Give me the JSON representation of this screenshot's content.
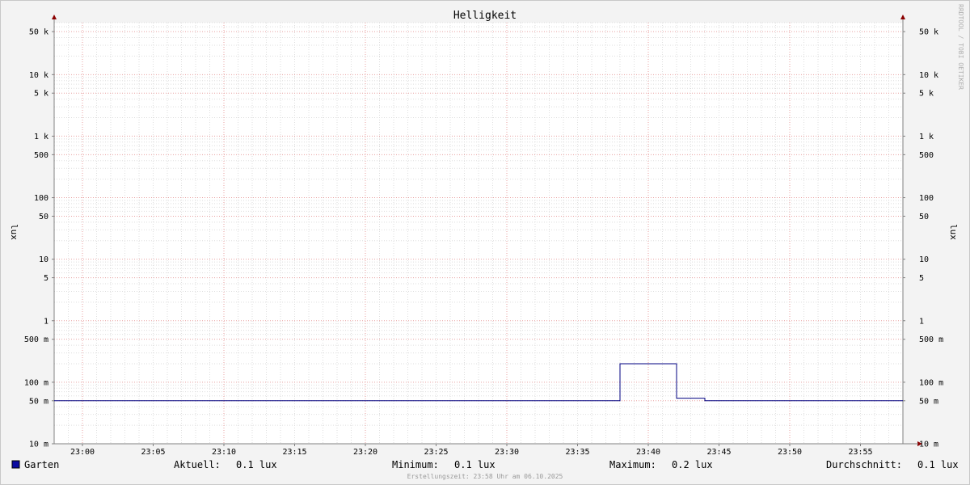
{
  "chart_data": {
    "type": "line",
    "title": "Helligkeit",
    "ylabel": "lux",
    "ylabel_right": "lux",
    "yscale": "log",
    "ylim": [
      0.01,
      70000
    ],
    "y_ticks": [
      {
        "value": 50000,
        "label": "50 k"
      },
      {
        "value": 10000,
        "label": "10 k"
      },
      {
        "value": 5000,
        "label": "5 k"
      },
      {
        "value": 1000,
        "label": "1 k"
      },
      {
        "value": 500,
        "label": "500"
      },
      {
        "value": 100,
        "label": "100"
      },
      {
        "value": 50,
        "label": "50"
      },
      {
        "value": 10,
        "label": "10"
      },
      {
        "value": 5,
        "label": "5"
      },
      {
        "value": 1,
        "label": "1"
      },
      {
        "value": 0.5,
        "label": "500 m"
      },
      {
        "value": 0.1,
        "label": "100 m"
      },
      {
        "value": 0.05,
        "label": "50 m"
      },
      {
        "value": 0.01,
        "label": "10 m"
      }
    ],
    "xlim": [
      "22:58",
      "23:58"
    ],
    "x_ticks": [
      "23:00",
      "23:05",
      "23:10",
      "23:15",
      "23:20",
      "23:25",
      "23:30",
      "23:35",
      "23:40",
      "23:45",
      "23:50",
      "23:55"
    ],
    "grid": true,
    "series": [
      {
        "name": "Garten",
        "color": "#000080",
        "x": [
          "22:58",
          "23:38",
          "23:38",
          "23:42",
          "23:42",
          "23:44",
          "23:44",
          "23:58"
        ],
        "y": [
          0.05,
          0.05,
          0.2,
          0.2,
          0.055,
          0.055,
          0.05,
          0.05
        ]
      }
    ],
    "legend": {
      "position": "bottom",
      "swatch_color": "#0a0aa0",
      "label": "Garten",
      "stats": [
        {
          "label": "Aktuell:",
          "value": "0.1 lux"
        },
        {
          "label": "Minimum:",
          "value": "0.1 lux"
        },
        {
          "label": "Maximum:",
          "value": "0.2 lux"
        },
        {
          "label": "Durchschnitt:",
          "value": "0.1 lux"
        }
      ]
    },
    "footer": "Erstellungszeit: 23:58 Uhr am 06.10.2025",
    "watermark": "RRDTOOL / TOBI OETIKER",
    "colors": {
      "background": "#f3f3f3",
      "plot_background": "#ffffff",
      "minor_grid": "#dedede",
      "major_grid": "#e8a0a0",
      "axis": "#808080",
      "arrow": "#8b0000"
    }
  }
}
